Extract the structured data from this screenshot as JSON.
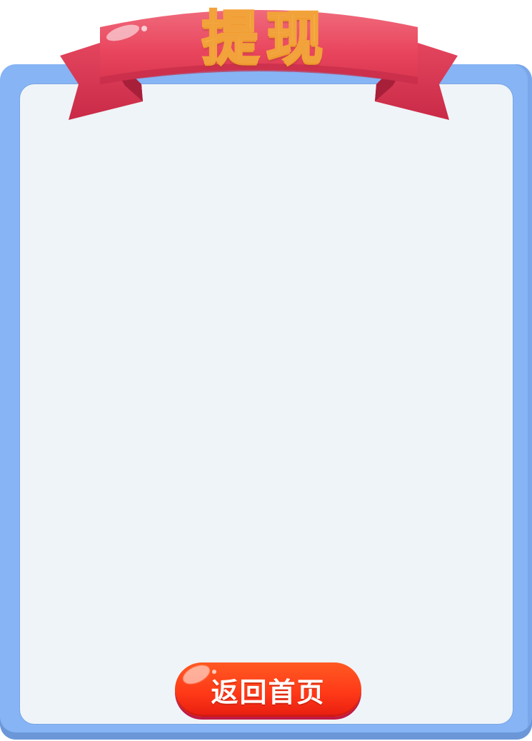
{
  "header": {
    "title": "提现"
  },
  "actions": {
    "home_label": "返回首页"
  },
  "colors": {
    "frame": "#86b4f4",
    "panel": "#eff4f8",
    "ribbon": "#e8455f",
    "title_fill": "#ffd76a",
    "button": "#ff3a18"
  }
}
